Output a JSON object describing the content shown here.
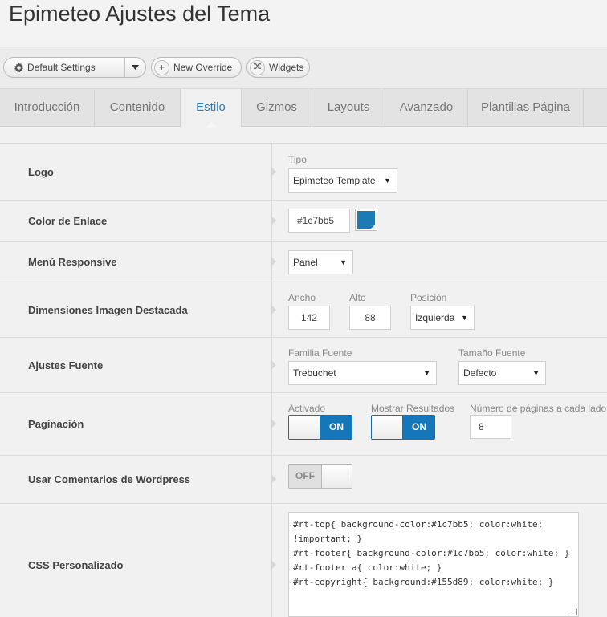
{
  "page": {
    "title": "Epimeteo Ajustes del Tema"
  },
  "toolbar": {
    "settings_select": {
      "label": "Default Settings",
      "icon": "gear-icon"
    },
    "new_override": {
      "label": "New Override",
      "icon": "plus-icon"
    },
    "widgets": {
      "label": "Widgets",
      "icon": "shuffle-icon"
    }
  },
  "tabs": [
    {
      "label": "Introducción",
      "active": false
    },
    {
      "label": "Contenido",
      "active": false
    },
    {
      "label": "Estilo",
      "active": true
    },
    {
      "label": "Gizmos",
      "active": false
    },
    {
      "label": "Layouts",
      "active": false
    },
    {
      "label": "Avanzado",
      "active": false
    },
    {
      "label": "Plantillas Página",
      "active": false
    }
  ],
  "rows": {
    "logo": {
      "label": "Logo",
      "tipo_label": "Tipo",
      "tipo_value": "Epimeteo Template"
    },
    "link_color": {
      "label": "Color de Enlace",
      "value": "#1c7bb5",
      "swatch_color": "#1c7bb5"
    },
    "responsive_menu": {
      "label": "Menú Responsive",
      "value": "Panel"
    },
    "featured_image": {
      "label": "Dimensiones Imagen Destacada",
      "width_label": "Ancho",
      "width_value": "142",
      "height_label": "Alto",
      "height_value": "88",
      "position_label": "Posición",
      "position_value": "Izquierda"
    },
    "font": {
      "label": "Ajustes Fuente",
      "family_label": "Familia Fuente",
      "family_value": "Trebuchet",
      "size_label": "Tamaño Fuente",
      "size_value": "Defecto"
    },
    "pagination": {
      "label": "Paginación",
      "enabled_label": "Activado",
      "enabled_state": "ON",
      "show_results_label": "Mostrar Resultados",
      "show_results_state": "ON",
      "pages_label": "Número de páginas a cada lado",
      "pages_value": "8"
    },
    "wp_comments": {
      "label": "Usar Comentarios de Wordpress",
      "state": "OFF"
    },
    "custom_css": {
      "label": "CSS Personalizado",
      "lines": [
        "#rt-top{ background-color:#1c7bb5; color:white;",
        "!important; }",
        "#rt-footer{ background-color:#1c7bb5; color:white; }",
        "#rt-footer a{ color:white; }",
        "#rt-copyright{ background:#155d89; color:white; }"
      ]
    }
  },
  "colors": {
    "accent": "#1577b9",
    "link": "#1c7bb5"
  }
}
